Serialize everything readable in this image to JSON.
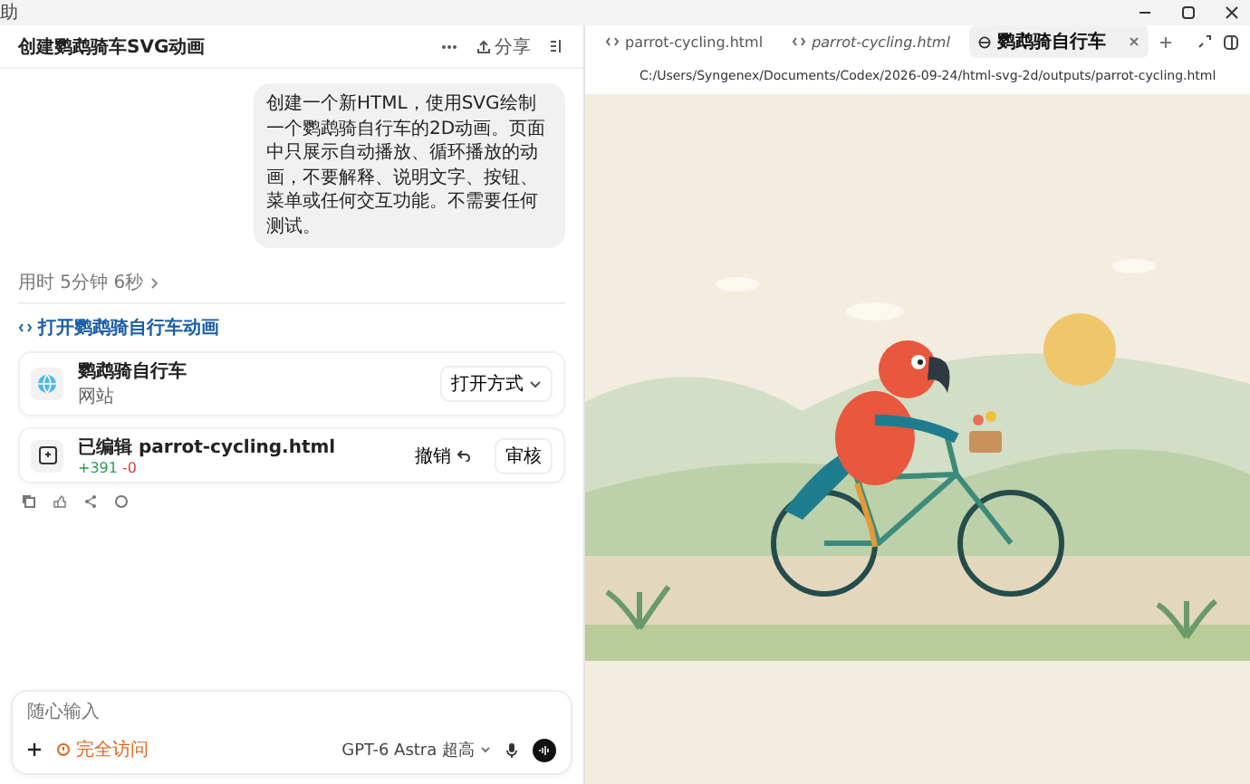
{
  "menu_bar": {
    "items": [
      "助"
    ]
  },
  "chat": {
    "title": "创建鹦鹉骑车SVG动画",
    "share": "分享",
    "user_message": "创建一个新HTML，使用SVG绘制一个鹦鹉骑自行车的2D动画。页面中只展示自动播放、循环播放的动画，不要解释、说明文字、按钮、菜单或任何交互功能。不需要任何测试。",
    "elapsed": "用时 5分钟 6秒",
    "link": "打开鹦鹉骑自行车动画",
    "cards": [
      {
        "kind": "site",
        "title": "鹦鹉骑自行车",
        "subtitle": "网站",
        "actions": [
          "打开方式"
        ]
      },
      {
        "kind": "edit",
        "title": "已编辑 parrot-cycling.html",
        "additions": "+391",
        "deletions": "-0",
        "actions": [
          "撤销",
          "审核"
        ]
      }
    ],
    "input": {
      "placeholder": "随心输入",
      "access": "完全访问",
      "model": "GPT-6 Astra 超高"
    }
  },
  "browser": {
    "tabs": [
      {
        "label": "parrot-cycling.html",
        "kind": "code",
        "preview": false,
        "selected": false
      },
      {
        "label": "parrot-cycling.html",
        "kind": "code",
        "preview": true,
        "selected": false
      },
      {
        "label": "鹦鹉骑自行车",
        "kind": "page",
        "preview": false,
        "selected": true
      }
    ],
    "address": "C:/Users/Syngenex/Documents/Codex/2026-09-24/html-svg-2d/outputs/parrot-cycling.html"
  }
}
